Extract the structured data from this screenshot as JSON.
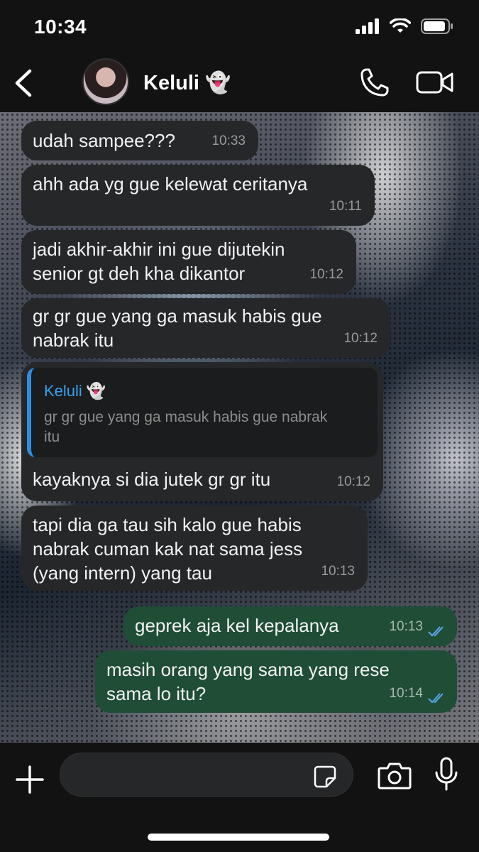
{
  "status_bar": {
    "time": "10:34"
  },
  "header": {
    "contact_name": "Keluli 👻"
  },
  "messages": [
    {
      "type": "in",
      "text": "udah sampee???",
      "time": "10:33"
    },
    {
      "type": "in",
      "text": "ahh ada yg gue kelewat ceritanya",
      "time": "10:11"
    },
    {
      "type": "in",
      "text_lines": [
        "jadi akhir-akhir ini gue dijutekin",
        "senior gt deh kha dikantor"
      ],
      "time": "10:12"
    },
    {
      "type": "in",
      "text_lines": [
        "gr gr gue yang ga masuk habis gue",
        "nabrak itu"
      ],
      "time": "10:12"
    },
    {
      "type": "in",
      "quote": {
        "name": "Keluli 👻",
        "text": "gr gr gue yang ga masuk habis gue nabrak itu"
      },
      "text": "kayaknya si dia jutek gr gr itu",
      "time": "10:12"
    },
    {
      "type": "in",
      "text_lines": [
        "tapi dia ga tau sih kalo gue habis",
        "nabrak cuman kak nat sama jess",
        "(yang intern) yang tau"
      ],
      "time": "10:13"
    },
    {
      "type": "out",
      "text": "geprek aja kel kepalanya",
      "time": "10:13",
      "status": "read"
    },
    {
      "type": "out",
      "text_lines": [
        "masih orang yang sama yang rese",
        "sama lo itu?"
      ],
      "time": "10:14",
      "status": "read"
    }
  ],
  "colors": {
    "incoming": "#262729",
    "outgoing": "#1f4d36",
    "read_tick": "#5aa9ee",
    "quote_accent": "#2d8ee0"
  }
}
